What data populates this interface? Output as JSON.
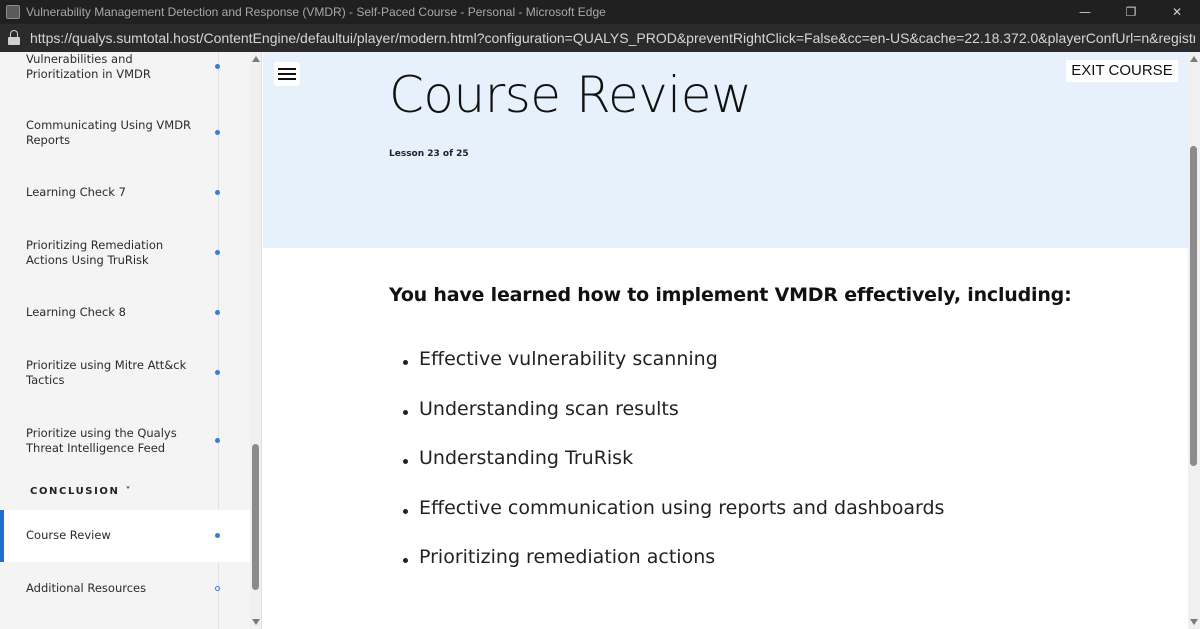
{
  "window": {
    "title": "Vulnerability Management Detection and Response (VMDR) - Self-Paced Course - Personal - Microsoft Edge",
    "minimize_icon": "minimize-icon",
    "restore_icon": "restore-icon",
    "close_icon": "close-icon"
  },
  "address": {
    "url": "https://qualys.sumtotal.host/ContentEngine/defaultui/player/modern.html?configuration=QUALYS_PROD&preventRightClick=False&cc=en-US&cache=22.18.372.0&playerConfUrl=n&registration=..."
  },
  "sidebar": {
    "items": [
      {
        "label": "Vulnerabilities and Prioritization in VMDR",
        "status": "complete"
      },
      {
        "label": "Communicating Using VMDR Reports",
        "status": "complete"
      },
      {
        "label": "Learning Check 7",
        "status": "complete"
      },
      {
        "label": "Prioritizing Remediation Actions Using TruRisk",
        "status": "complete"
      },
      {
        "label": "Learning Check 8",
        "status": "complete"
      },
      {
        "label": "Prioritize using Mitre Att&ck Tactics",
        "status": "complete"
      },
      {
        "label": "Prioritize using the Qualys Threat Intelligence Feed",
        "status": "complete"
      }
    ],
    "section": {
      "label": "CONCLUSION",
      "chevron": "˅"
    },
    "section_items": [
      {
        "label": "Course Review",
        "status": "complete",
        "active": true
      },
      {
        "label": "Additional Resources",
        "status": "incomplete"
      }
    ]
  },
  "header": {
    "menu_icon": "hamburger-menu-icon",
    "exit_label": "EXIT COURSE",
    "title": "Course Review",
    "lesson": "Lesson 23 of 25"
  },
  "content": {
    "intro": "You have learned how to implement VMDR effectively, including:",
    "bullets": [
      "Effective vulnerability scanning",
      "Understanding scan results",
      "Understanding TruRisk",
      "Effective communication using reports and dashboards",
      "Prioritizing remediation actions"
    ]
  },
  "colors": {
    "accent": "#1e6fd0",
    "hero_bg": "#e6f1fb",
    "sidebar_bg": "#f4f4f4"
  }
}
